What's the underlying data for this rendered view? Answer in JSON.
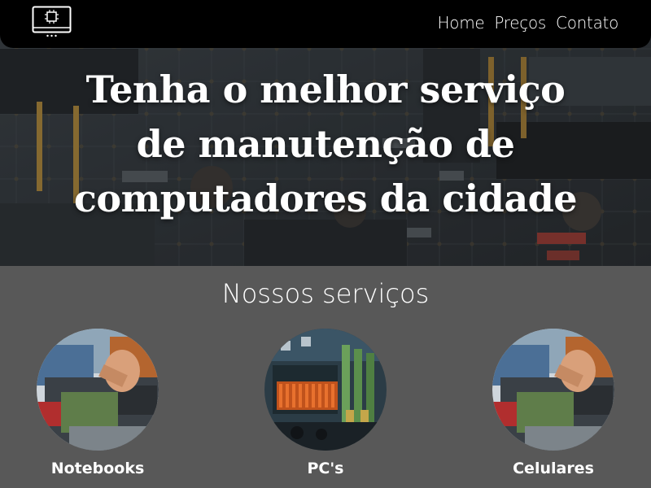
{
  "nav": {
    "logo_icon": "computer-monitor-icon",
    "links": [
      {
        "label": "Home"
      },
      {
        "label": "Preços"
      },
      {
        "label": "Contato"
      }
    ]
  },
  "hero": {
    "title_lines": [
      "Tenha o melhor serviço",
      "de manutenção de",
      "computadores da cidade"
    ],
    "background": "circuit-board-photo"
  },
  "services": {
    "heading": "Nossos serviços",
    "items": [
      {
        "label": "Notebooks",
        "image": "laptop-repair-photo"
      },
      {
        "label": "PC's",
        "image": "motherboard-photo"
      },
      {
        "label": "Celulares",
        "image": "laptop-repair-photo"
      }
    ]
  },
  "colors": {
    "nav_bg": "#000000",
    "page_bg": "#585858",
    "text": "#ffffff"
  }
}
